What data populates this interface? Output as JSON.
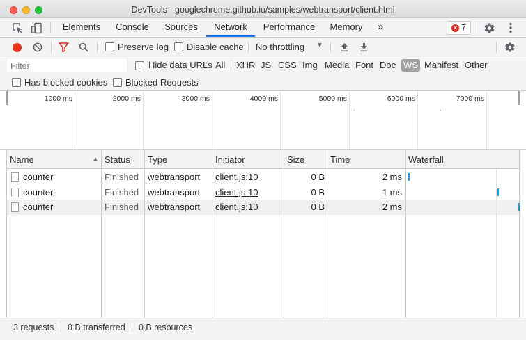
{
  "window": {
    "title": "DevTools - googlechrome.github.io/samples/webtransport/client.html"
  },
  "tabs": [
    "Elements",
    "Console",
    "Sources",
    "Network",
    "Performance",
    "Memory"
  ],
  "tabs_more": "»",
  "error_badge": {
    "count": "7",
    "color": "#d93025"
  },
  "toolbar": {
    "preserve_log": "Preserve log",
    "disable_cache": "Disable cache",
    "throttling": "No throttling",
    "throttling_arrow": "▼"
  },
  "filter": {
    "placeholder": "Filter",
    "hide_data_urls": "Hide data URLs",
    "types": [
      "All",
      "XHR",
      "JS",
      "CSS",
      "Img",
      "Media",
      "Font",
      "Doc",
      "WS",
      "Manifest",
      "Other"
    ],
    "selected_type": "WS",
    "has_blocked_cookies": "Has blocked cookies",
    "blocked_requests": "Blocked Requests"
  },
  "overview": {
    "ticks": [
      "1000 ms",
      "2000 ms",
      "3000 ms",
      "4000 ms",
      "5000 ms",
      "6000 ms",
      "7000 ms"
    ]
  },
  "table": {
    "columns": [
      "Name",
      "Status",
      "Type",
      "Initiator",
      "Size",
      "Time",
      "Waterfall"
    ],
    "sort_indicator": "▲",
    "rows": [
      {
        "name": "counter",
        "status": "Finished",
        "type": "webtransport",
        "initiator": "client.js:10",
        "size": "0 B",
        "time": "2 ms"
      },
      {
        "name": "counter",
        "status": "Finished",
        "type": "webtransport",
        "initiator": "client.js:10",
        "size": "0 B",
        "time": "1 ms"
      },
      {
        "name": "counter",
        "status": "Finished",
        "type": "webtransport",
        "initiator": "client.js:10",
        "size": "0 B",
        "time": "2 ms"
      }
    ]
  },
  "status": {
    "requests": "3 requests",
    "transferred": "0 B transferred",
    "resources": "0 B resources"
  },
  "colors": {
    "accent": "#1a73e8",
    "record": "#e5321b",
    "filter_icon": "#d93025",
    "waterfall_bar": "#1a9be0"
  }
}
